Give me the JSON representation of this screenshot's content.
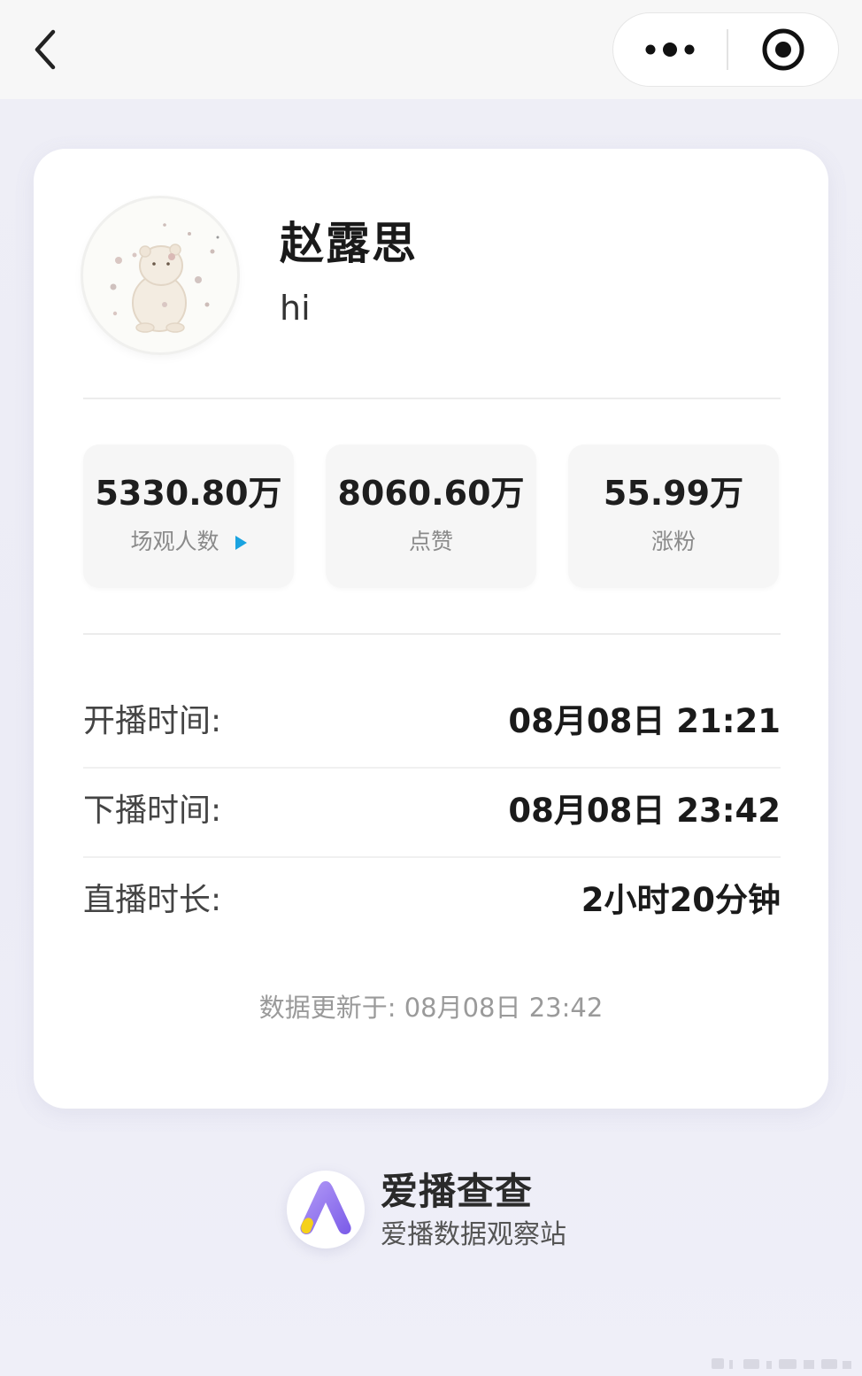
{
  "topbar": {
    "back_icon": "chevron-left-icon",
    "more_icon": "more-dots-icon",
    "close_icon": "target-close-icon"
  },
  "profile": {
    "name": "赵露思",
    "bio": "hi",
    "avatar_icon": "bear-avatar"
  },
  "stats": [
    {
      "value": "5330.80万",
      "label": "场观人数"
    },
    {
      "value": "8060.60万",
      "label": "点赞"
    },
    {
      "value": "55.99万",
      "label": "涨粉"
    }
  ],
  "details": [
    {
      "key": "开播时间:",
      "value": "08月08日 21:21"
    },
    {
      "key": "下播时间:",
      "value": "08月08日 23:42"
    },
    {
      "key": "直播时长:",
      "value": "2小时20分钟"
    }
  ],
  "updated": "数据更新于: 08月08日 23:42",
  "brand": {
    "name": "爱播查查",
    "subtitle": "爱播数据观察站",
    "logo_icon": "aibo-logo-icon"
  },
  "colors": {
    "accent": "#1aa3e0",
    "logo_purple": "#8a6ff0",
    "logo_yellow": "#f5d11a"
  }
}
